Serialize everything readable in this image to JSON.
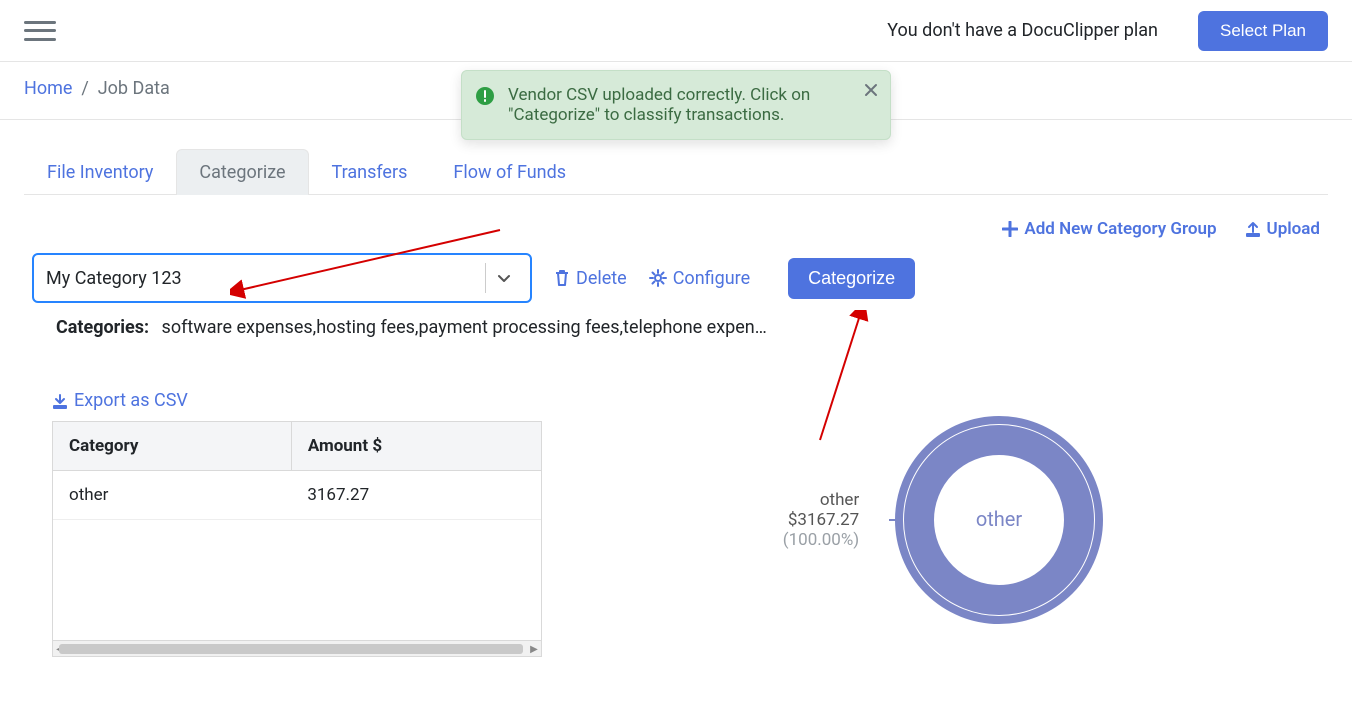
{
  "header": {
    "plan_message": "You don't have a DocuClipper plan",
    "select_plan_label": "Select Plan"
  },
  "breadcrumb": {
    "home_label": "Home",
    "current": "Job Data"
  },
  "tabs": {
    "file_inventory": "File Inventory",
    "categorize": "Categorize",
    "transfers": "Transfers",
    "flow_of_funds": "Flow of Funds"
  },
  "toolbar": {
    "add_group": "Add New Category Group",
    "upload": "Upload"
  },
  "category_picker": {
    "value": "My Category 123"
  },
  "actions": {
    "delete": "Delete",
    "configure": "Configure",
    "categorize": "Categorize",
    "export_csv": "Export as CSV"
  },
  "categories_summary": {
    "label": "Categories:",
    "text": "software expenses,hosting fees,payment processing fees,telephone expen…"
  },
  "table": {
    "col_category": "Category",
    "col_amount": "Amount $",
    "rows": [
      {
        "category": "other",
        "amount": "3167.27"
      }
    ]
  },
  "toast": {
    "message": "Vendor CSV uploaded correctly. Click on \"Categorize\" to classify transactions."
  },
  "chart_data": {
    "type": "pie",
    "title": "",
    "series": [
      {
        "name": "other",
        "value": 3167.27,
        "percent": 100.0
      }
    ],
    "center_label": "other",
    "legend_label_name": "other",
    "legend_label_amount": "$3167.27",
    "legend_label_percent": "(100.00%)"
  }
}
